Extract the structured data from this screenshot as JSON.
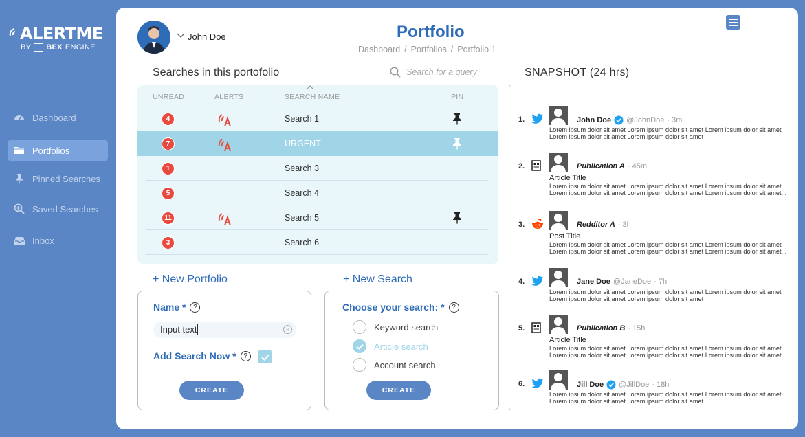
{
  "brand": {
    "name": "ALERTME",
    "by": "BY",
    "engine_bold": "BEX",
    "engine": "ENGINE"
  },
  "sidebar": {
    "items": [
      {
        "label": "Dashboard",
        "icon": "dashboard-icon",
        "active": false
      },
      {
        "label": "Portfolios",
        "icon": "folder-icon",
        "active": true
      },
      {
        "label": "Pinned Searches",
        "icon": "pin-icon",
        "active": false
      },
      {
        "label": "Saved Searches",
        "icon": "search-plus-icon",
        "active": false
      },
      {
        "label": "Inbox",
        "icon": "inbox-icon",
        "active": false
      }
    ]
  },
  "header": {
    "user_name": "John Doe",
    "title": "Portfolio",
    "breadcrumb": [
      "Dashboard",
      "/",
      "Portfolios",
      "/",
      "Portfolio 1"
    ]
  },
  "searches": {
    "title": "Searches in this portofolio",
    "search_placeholder": "Search for a query",
    "columns": {
      "unread": "UNREAD",
      "alerts": "ALERTS",
      "name": "SEARCH NAME",
      "pin": "PIN"
    },
    "rows": [
      {
        "unread": "4",
        "alert": true,
        "name": "Search 1",
        "pinned": true,
        "highlight": false
      },
      {
        "unread": "7",
        "alert": true,
        "name": "URGENT",
        "pinned": true,
        "highlight": true
      },
      {
        "unread": "1",
        "alert": false,
        "name": "Search 3",
        "pinned": false,
        "highlight": false
      },
      {
        "unread": "5",
        "alert": false,
        "name": "Search 4",
        "pinned": false,
        "highlight": false
      },
      {
        "unread": "11",
        "alert": true,
        "name": "Search 5",
        "pinned": true,
        "highlight": false
      },
      {
        "unread": "3",
        "alert": false,
        "name": "Search 6",
        "pinned": false,
        "highlight": false
      }
    ]
  },
  "new_portfolio": {
    "link": "+ New Portfolio",
    "name_label": "Name *",
    "name_value": "Input text",
    "add_now_label": "Add Search Now *",
    "add_now_checked": true,
    "create": "CREATE"
  },
  "new_search": {
    "link": "+ New Search",
    "choose_label": "Choose your search: *",
    "options": [
      {
        "label": "Keyword search",
        "checked": false
      },
      {
        "label": "Article search",
        "checked": true
      },
      {
        "label": "Account search",
        "checked": false
      }
    ],
    "create": "CREATE"
  },
  "snapshot": {
    "title": "SNAPSHOT (24 hrs)",
    "items": [
      {
        "num": "1.",
        "source": "twitter-icon",
        "name": "John Doe",
        "verified": true,
        "handle": "@JohnDoe",
        "time": "· 3m",
        "sub": "",
        "body": "Lorem ipsum dolor sit amet Lorem ipsum dolor sit amet Lorem ipsum dolor sit amet Lorem ipsum dolor sit amet Lorem ipsum dolor sit amet"
      },
      {
        "num": "2.",
        "source": "publication-icon",
        "name": "Publication A",
        "verified": false,
        "handle": "",
        "time": "· 45m",
        "sub": "Article Title",
        "body": "Lorem ipsum dolor sit amet Lorem ipsum dolor sit amet Lorem ipsum dolor sit amet Lorem ipsum dolor sit amet Lorem ipsum dolor sit amet Lorem ipsum dolor sit amet..."
      },
      {
        "num": "3.",
        "source": "reddit-icon",
        "name": "Redditor A",
        "verified": false,
        "handle": "",
        "time": "· 3h",
        "sub": "Post Title",
        "body": "Lorem ipsum dolor sit amet Lorem ipsum dolor sit amet Lorem ipsum dolor sit amet Lorem ipsum dolor sit amet Lorem ipsum dolor sit amet Lorem ipsum dolor sit amet..."
      },
      {
        "num": "4.",
        "source": "twitter-icon",
        "name": "Jane Doe",
        "verified": false,
        "handle": "@JaneDoe",
        "time": "· 7h",
        "sub": "",
        "body": "Lorem ipsum dolor sit amet Lorem ipsum dolor sit amet Lorem ipsum dolor sit amet Lorem ipsum dolor sit amet Lorem ipsum dolor sit amet"
      },
      {
        "num": "5.",
        "source": "publication-icon",
        "name": "Publication B",
        "verified": false,
        "handle": "",
        "time": "· 15h",
        "sub": "Article Title",
        "body": "Lorem ipsum dolor sit amet Lorem ipsum dolor sit amet Lorem ipsum dolor sit amet Lorem ipsum dolor sit amet Lorem ipsum dolor sit amet Lorem ipsum dolor sit amet..."
      },
      {
        "num": "6.",
        "source": "twitter-icon",
        "name": "Jill Doe",
        "verified": true,
        "handle": "@JillDoe",
        "time": "· 18h",
        "sub": "",
        "body": "Lorem ipsum dolor sit amet Lorem ipsum dolor sit amet Lorem ipsum dolor sit amet Lorem ipsum dolor sit amet Lorem ipsum dolor sit amet"
      }
    ]
  },
  "colors": {
    "brand_blue": "#5b86c5",
    "title_blue": "#2f6cb8",
    "highlight": "#9fd5e6",
    "badge_red": "#e84a3f",
    "alert_red": "#e84a3f",
    "twitter": "#1da1f2",
    "reddit": "#ff4500"
  }
}
